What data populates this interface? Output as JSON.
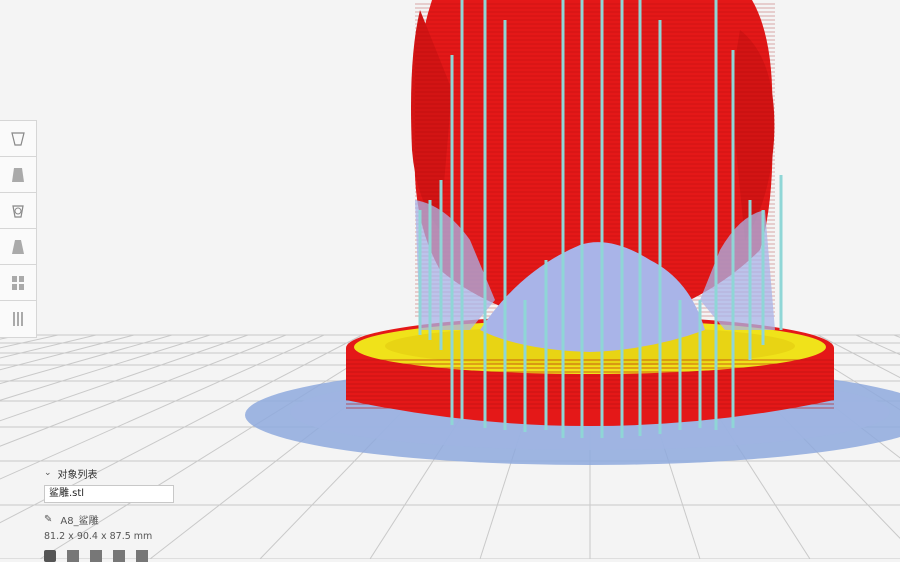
{
  "object_list": {
    "header_label": "对象列表",
    "file_name": "鲨雕.stl",
    "object_name": "A8_鲨雕",
    "dimensions": "81.2 x 90.4 x 87.5 mm"
  },
  "toolbar": {
    "tools": [
      "move-tool-icon",
      "scale-tool-icon",
      "rotate-tool-icon",
      "mirror-tool-icon",
      "per-model-settings-icon",
      "support-blocker-icon"
    ]
  },
  "colors": {
    "model_wall": "#e41818",
    "skin": "#f0e21a",
    "support": "#8fd6d6",
    "support_interface": "#a9b4e8",
    "brim": "#8ea9dd",
    "build_plate": "#f4f4f4"
  }
}
